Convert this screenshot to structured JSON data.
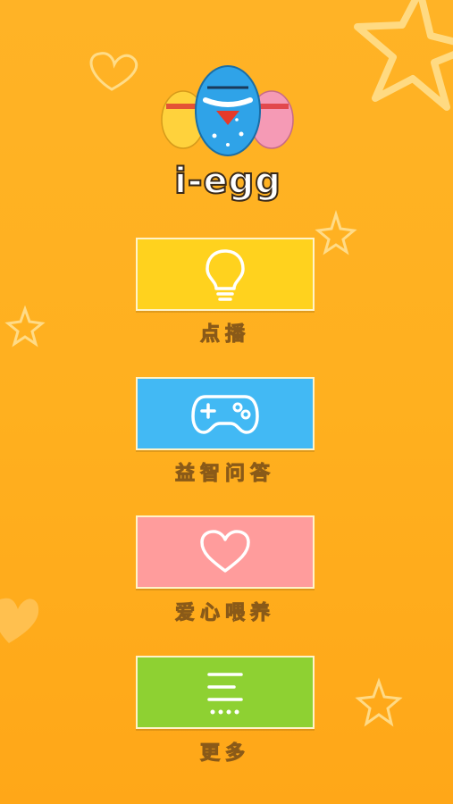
{
  "app": {
    "logo_text": "i-egg"
  },
  "menu": [
    {
      "label": "点播",
      "icon": "lightbulb-icon",
      "color": "#FFD21E"
    },
    {
      "label": "益智问答",
      "icon": "gamepad-icon",
      "color": "#42B9F4"
    },
    {
      "label": "爱心喂养",
      "icon": "heart-icon",
      "color": "#FF9C9C"
    },
    {
      "label": "更多",
      "icon": "more-menu-icon",
      "color": "#8ED132"
    }
  ]
}
